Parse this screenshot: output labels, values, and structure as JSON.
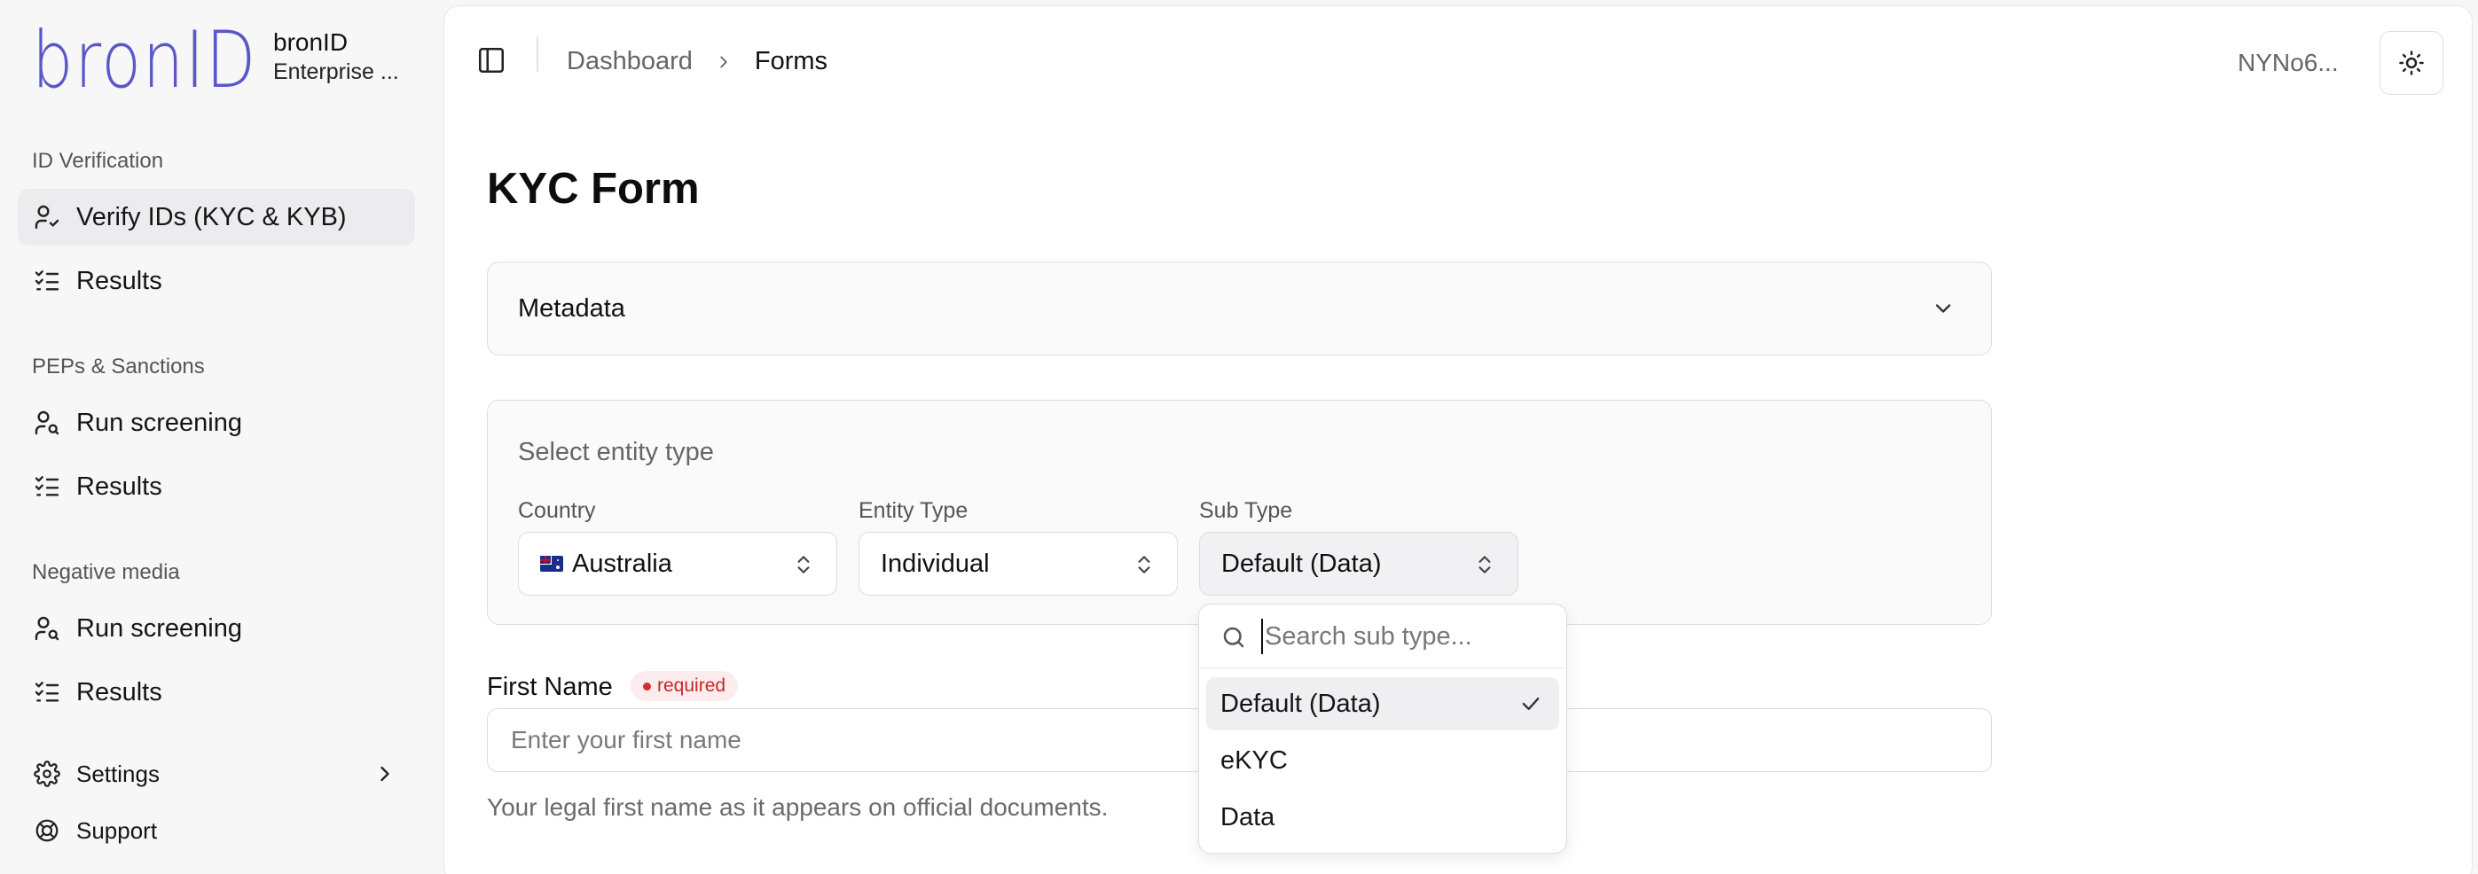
{
  "brand": {
    "logo_text": "bronID",
    "name": "bronID",
    "subtitle": "Enterprise ..."
  },
  "sidebar": {
    "groups": [
      {
        "label": "ID Verification",
        "items": [
          {
            "label": "Verify IDs (KYC & KYB)",
            "icon": "user-check-icon",
            "active": true
          },
          {
            "label": "Results",
            "icon": "list-checks-icon"
          }
        ]
      },
      {
        "label": "PEPs & Sanctions",
        "items": [
          {
            "label": "Run screening",
            "icon": "user-search-icon"
          },
          {
            "label": "Results",
            "icon": "list-checks-icon"
          }
        ]
      },
      {
        "label": "Negative media",
        "items": [
          {
            "label": "Run screening",
            "icon": "user-search-icon"
          },
          {
            "label": "Results",
            "icon": "list-checks-icon"
          }
        ]
      }
    ],
    "footer": [
      {
        "label": "Settings",
        "icon": "gear-icon"
      },
      {
        "label": "Support",
        "icon": "lifebuoy-icon"
      }
    ]
  },
  "header": {
    "breadcrumb": [
      "Dashboard",
      "Forms"
    ],
    "user_id": "NYNo6..."
  },
  "page": {
    "title": "KYC Form",
    "metadata_label": "Metadata",
    "entity_card": {
      "title": "Select entity type",
      "country": {
        "label": "Country",
        "value": "Australia"
      },
      "entity_type": {
        "label": "Entity Type",
        "value": "Individual"
      },
      "sub_type": {
        "label": "Sub Type",
        "value": "Default (Data)"
      }
    },
    "first_name": {
      "label": "First Name",
      "badge": "required",
      "placeholder": "Enter your first name",
      "helper": "Your legal first name as it appears on official documents."
    }
  },
  "dropdown": {
    "search_placeholder": "Search sub type...",
    "options": [
      "Default (Data)",
      "eKYC",
      "Data"
    ],
    "selected": "Default (Data)"
  },
  "colors": {
    "brand": "#5b57c9",
    "required_text": "#c62828",
    "required_bg": "#fdeced"
  }
}
